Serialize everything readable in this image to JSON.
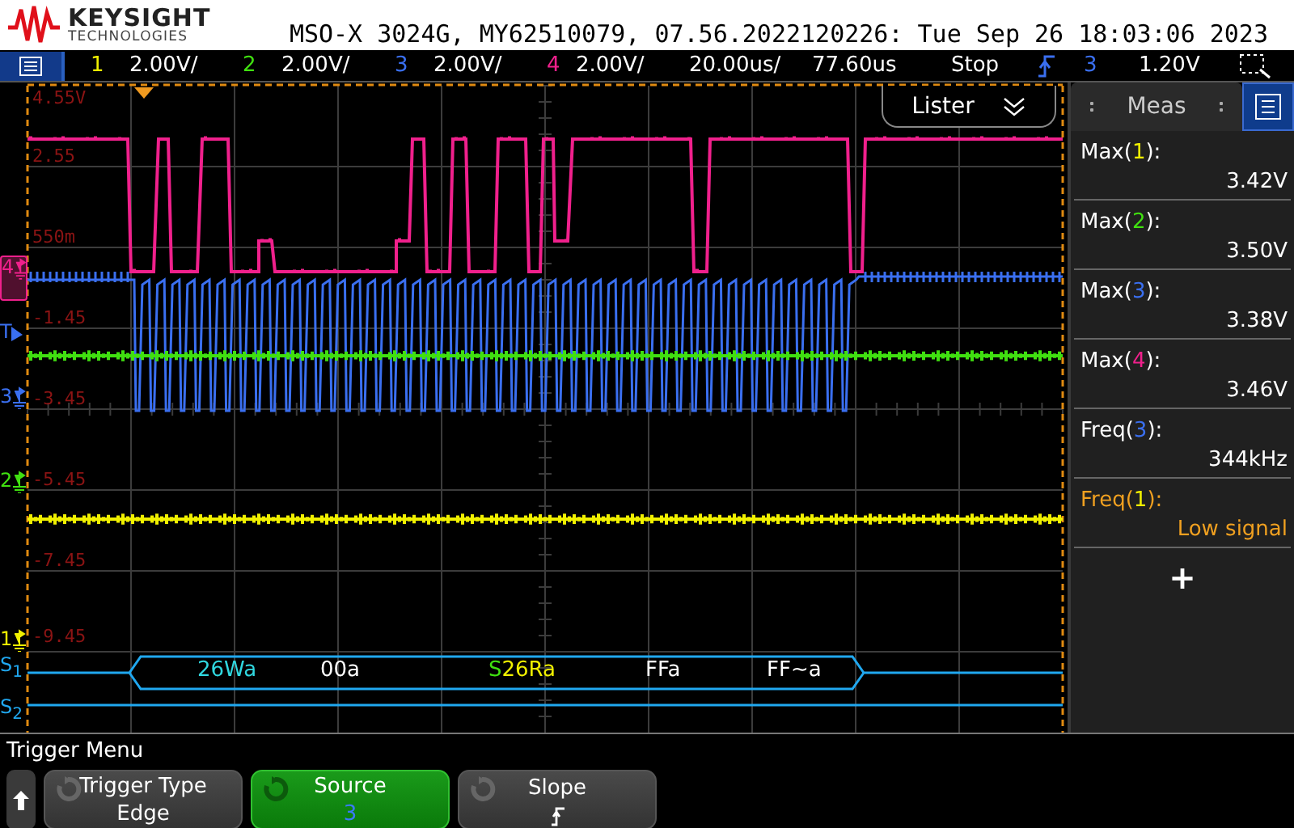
{
  "header": {
    "brand": "KEYSIGHT",
    "brand_sub": "TECHNOLOGIES",
    "info": "MSO-X 3024G, MY62510079, 07.56.2022120226: Tue Sep 26 18:03:06 2023"
  },
  "channels": [
    {
      "number": "1",
      "scale": "2.00V/",
      "color": "#f0f000"
    },
    {
      "number": "2",
      "scale": "2.00V/",
      "color": "#40e010"
    },
    {
      "number": "3",
      "scale": "2.00V/",
      "color": "#3a6ff0"
    },
    {
      "number": "4",
      "scale": "2.00V/",
      "color": "#f0208c"
    }
  ],
  "timebase": "20.00us/",
  "delay": "77.60us",
  "run_state": "Stop",
  "trigger": {
    "source": "3",
    "level": "1.20V"
  },
  "scale_labels": [
    "4.55V",
    "2.55",
    "550m",
    "-1.45",
    "-3.45",
    "-5.45",
    "-7.45",
    "-9.45"
  ],
  "markers": [
    {
      "label": "4",
      "kind": "ground",
      "color": "#f0208c",
      "selected": true
    },
    {
      "label": "T",
      "kind": "trigger",
      "color": "#3a6ff0",
      "selected": false
    },
    {
      "label": "3",
      "kind": "ground",
      "color": "#3a6ff0",
      "selected": false
    },
    {
      "label": "2",
      "kind": "ground",
      "color": "#40e010",
      "selected": false
    },
    {
      "label": "1",
      "kind": "ground",
      "color": "#f0f000",
      "selected": false
    },
    {
      "label": "S$_{1}$",
      "kind": "bus",
      "color": "#20a8f0",
      "selected": false
    },
    {
      "label": "S$_{2}$",
      "kind": "bus",
      "color": "#20a8f0",
      "selected": false
    }
  ],
  "bus_packets": [
    {
      "parts": [
        {
          "text": "26Wa",
          "color": "#30d8e0"
        }
      ]
    },
    {
      "parts": [
        {
          "text": "00a",
          "color": "#ffffff"
        }
      ]
    },
    {
      "parts": [
        {
          "text": "S",
          "color": "#40e010"
        },
        {
          "text": "26Ra",
          "color": "#f0f000"
        }
      ]
    },
    {
      "parts": [
        {
          "text": "FFa",
          "color": "#ffffff"
        }
      ]
    },
    {
      "parts": [
        {
          "text": "FF~a",
          "color": "#ffffff"
        }
      ]
    }
  ],
  "lister_button": "Lister",
  "meas_panel": {
    "title": "Meas",
    "add": "+"
  },
  "measurements": [
    {
      "function": "Max(",
      "source": "1",
      "close": "):",
      "color": "#f0f000",
      "value": "3.42V",
      "alert": false
    },
    {
      "function": "Max(",
      "source": "2",
      "close": "):",
      "color": "#40e010",
      "value": "3.50V",
      "alert": false
    },
    {
      "function": "Max(",
      "source": "3",
      "close": "):",
      "color": "#3a6ff0",
      "value": "3.38V",
      "alert": false
    },
    {
      "function": "Max(",
      "source": "4",
      "close": "):",
      "color": "#f0208c",
      "value": "3.46V",
      "alert": false
    },
    {
      "function": "Freq(",
      "source": "3",
      "close": "):",
      "color": "#3a6ff0",
      "value": "344kHz",
      "alert": false
    },
    {
      "function": "Freq(",
      "source": "1",
      "close": "):",
      "color": "#f0f000",
      "value": "Low signal",
      "alert": true
    }
  ],
  "menu_title": "Trigger Menu",
  "softkeys": [
    {
      "title": "Trigger Type",
      "kind": "text",
      "value": "Edge",
      "selected": false
    },
    {
      "title": "Source",
      "kind": "text",
      "value": "3",
      "selected": true
    },
    {
      "title": "Slope",
      "kind": "slope",
      "selected": false
    }
  ]
}
